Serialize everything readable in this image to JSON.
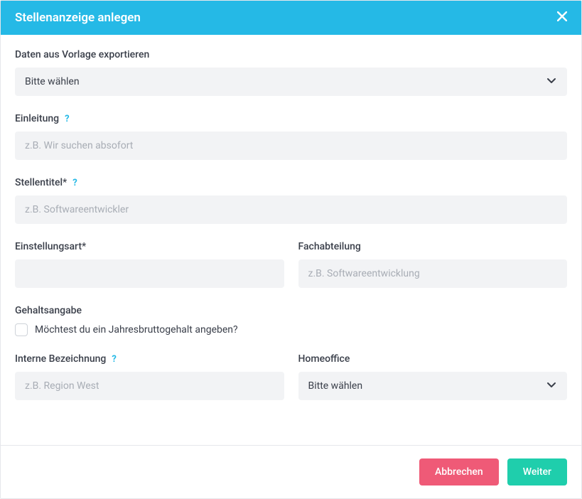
{
  "modal": {
    "title": "Stellenanzeige anlegen"
  },
  "form": {
    "template": {
      "label": "Daten aus Vorlage exportieren",
      "selected": "Bitte wählen"
    },
    "intro": {
      "label": "Einleitung",
      "placeholder": "z.B. Wir suchen absofort"
    },
    "jobtitle": {
      "label": "Stellentitel*",
      "placeholder": "z.B. Softwareentwickler"
    },
    "employment": {
      "label": "Einstellungsart*"
    },
    "department": {
      "label": "Fachabteilung",
      "placeholder": "z.B. Softwareentwicklung"
    },
    "salary": {
      "label": "Gehaltsangabe",
      "checkbox_label": "Möchtest du ein Jahresbruttogehalt angeben?"
    },
    "internal": {
      "label": "Interne Bezeichnung",
      "placeholder": "z.B. Region West"
    },
    "homeoffice": {
      "label": "Homeoffice",
      "selected": "Bitte wählen"
    }
  },
  "footer": {
    "cancel": "Abbrechen",
    "next": "Weiter"
  }
}
